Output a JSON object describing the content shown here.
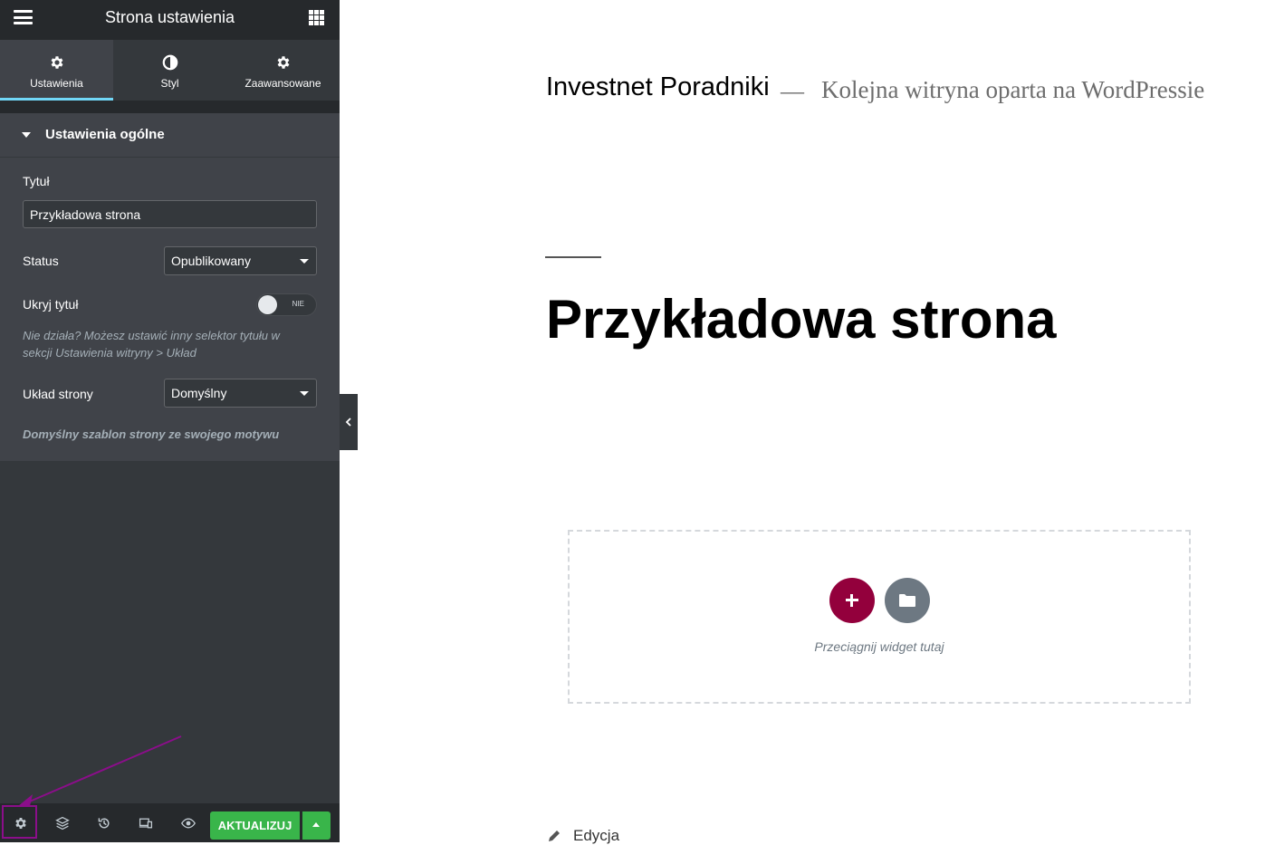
{
  "panel": {
    "header": {
      "title": "Strona ustawienia",
      "menu_icon": "hamburger-icon",
      "apps_icon": "grid-icon"
    },
    "tabs": [
      {
        "label": "Ustawienia",
        "icon": "gear-icon",
        "active": true
      },
      {
        "label": "Styl",
        "icon": "half-circle-icon",
        "active": false
      },
      {
        "label": "Zaawansowane",
        "icon": "gear-icon",
        "active": false
      }
    ],
    "section": {
      "title": "Ustawienia ogólne",
      "title_field": {
        "label": "Tytuł",
        "value": "Przykładowa strona"
      },
      "status": {
        "label": "Status",
        "value": "Opublikowany"
      },
      "hide_title": {
        "label": "Ukryj tytuł",
        "switch_label": "NIE",
        "on": false
      },
      "hide_title_note": "Nie działa? Możesz ustawić inny selektor tytułu w sekcji Ustawienia witryny > Układ",
      "layout": {
        "label": "Układ strony",
        "value": "Domyślny"
      },
      "layout_note": "Domyślny szablon strony ze swojego motywu"
    },
    "footer": {
      "icons": [
        "gear-icon",
        "layers-icon",
        "history-icon",
        "responsive-icon",
        "eye-icon"
      ],
      "update_label": "AKTUALIZUJ"
    }
  },
  "preview": {
    "site_title": "Investnet Poradniki",
    "separator": "—",
    "site_description": "Kolejna witryna oparta na WordPressie",
    "page_title": "Przykładowa strona",
    "drop_text": "Przeciągnij widget tutaj",
    "edit_link": "Edycja"
  },
  "colors": {
    "panel_bg": "#34383c",
    "panel_dark": "#26292c",
    "tab_active_indicator": "#71d7f7",
    "update_button": "#39b54a",
    "add_button": "#93003c",
    "template_button": "#6d7882",
    "annotation_arrow": "#8b0e8a"
  }
}
